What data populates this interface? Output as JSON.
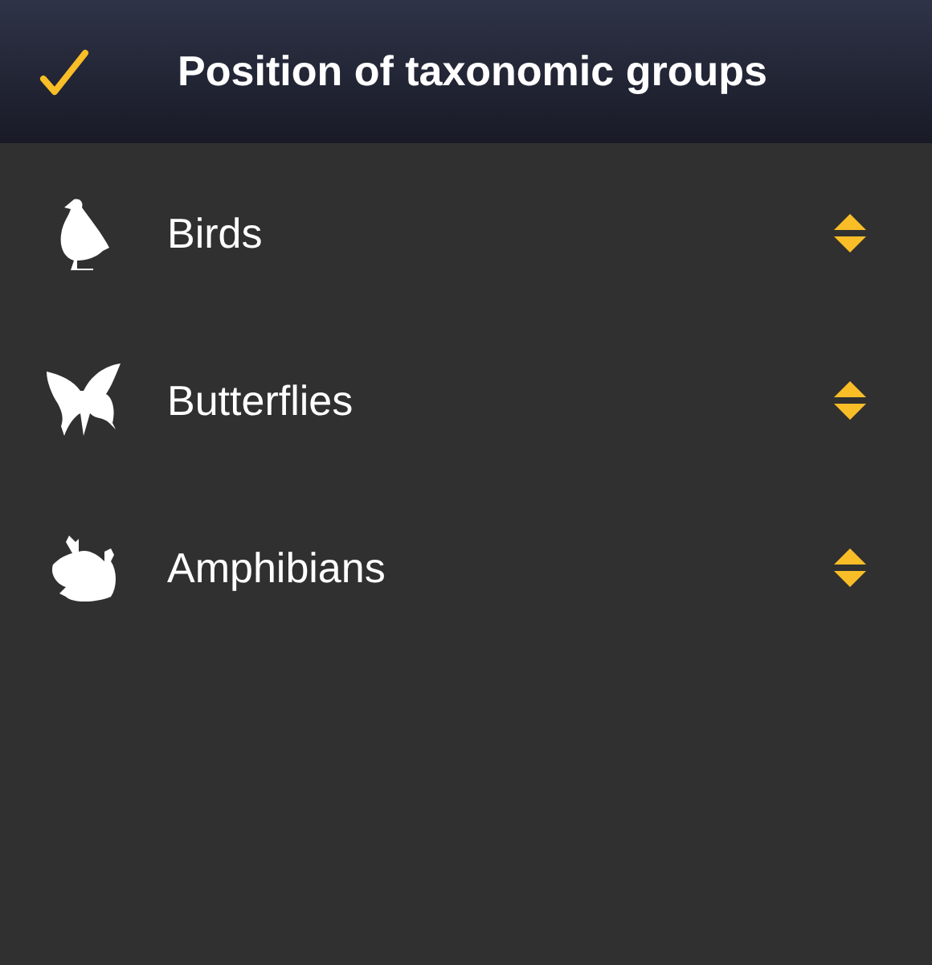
{
  "header": {
    "title": "Position of taxonomic groups"
  },
  "groups": [
    {
      "label": "Birds",
      "kind": "bird"
    },
    {
      "label": "Butterflies",
      "kind": "butterfly"
    },
    {
      "label": "Amphibians",
      "kind": "frog"
    }
  ]
}
